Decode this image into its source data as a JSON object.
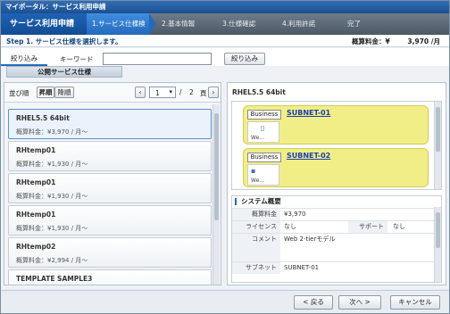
{
  "window": {
    "title": "マイポータル：サービス利用申請"
  },
  "wizard": {
    "main": "サービス利用申請",
    "steps": [
      "1.サービス仕様検索",
      "2.基本情報",
      "3.仕様確認",
      "4.利用許諾",
      "完了"
    ],
    "active_step": 0
  },
  "header": {
    "step_text": "Step 1. サービス仕様を選択します。",
    "cost_label": "概算料金：¥",
    "cost_value": "3,970 /月"
  },
  "filter": {
    "tab_label": "絞り込み",
    "keyword_label": "キーワード",
    "keyword_value": "",
    "button_label": "絞り込み"
  },
  "public_tab": "公開サービス仕様",
  "sort": {
    "label": "並び順",
    "asc": "昇順",
    "desc": "降順",
    "page_current": "1",
    "page_sep": "/",
    "page_total": "2",
    "page_unit": "頁"
  },
  "list": [
    {
      "title": "RHEL5.5 64bit",
      "price": "概算料金：¥3,970 / 月～"
    },
    {
      "title": "RHtemp01",
      "price": "概算料金：¥1,930 / 月～"
    },
    {
      "title": "RHtemp01",
      "price": "概算料金：¥1,930 / 月～"
    },
    {
      "title": "RHtemp01",
      "price": "概算料金：¥1,930 / 月～"
    },
    {
      "title": "RHtemp02",
      "price": "概算料金：¥2,994 / 月～"
    },
    {
      "title": "TEMPLATE SAMPLE3",
      "price": ""
    }
  ],
  "detail": {
    "title": "RHEL5.5 64bit",
    "subnets": [
      {
        "badge": "Business",
        "name": "SUBNET-01",
        "vm_label": "We..."
      },
      {
        "badge": "Business",
        "name": "SUBNET-02",
        "vm_label": "We..."
      }
    ],
    "system": {
      "heading": "システム概要",
      "fee_label": "概算料金",
      "fee_value": "¥3,970",
      "license_label": "ライセンス",
      "license_value": "なし",
      "support_label": "サポート",
      "support_value": "なし",
      "comment_label": "コメント",
      "comment_value": "Web 2-tierモデル",
      "subnet_label": "サブネット",
      "subnet_value": "SUBNET-01"
    }
  },
  "footer": {
    "back": "< 戻る",
    "next": "次へ >",
    "cancel": "キャンセル"
  },
  "colors": {
    "accent": "#2469bd",
    "subnet_bg": "#f2ee87",
    "link": "#1a3fb0"
  }
}
